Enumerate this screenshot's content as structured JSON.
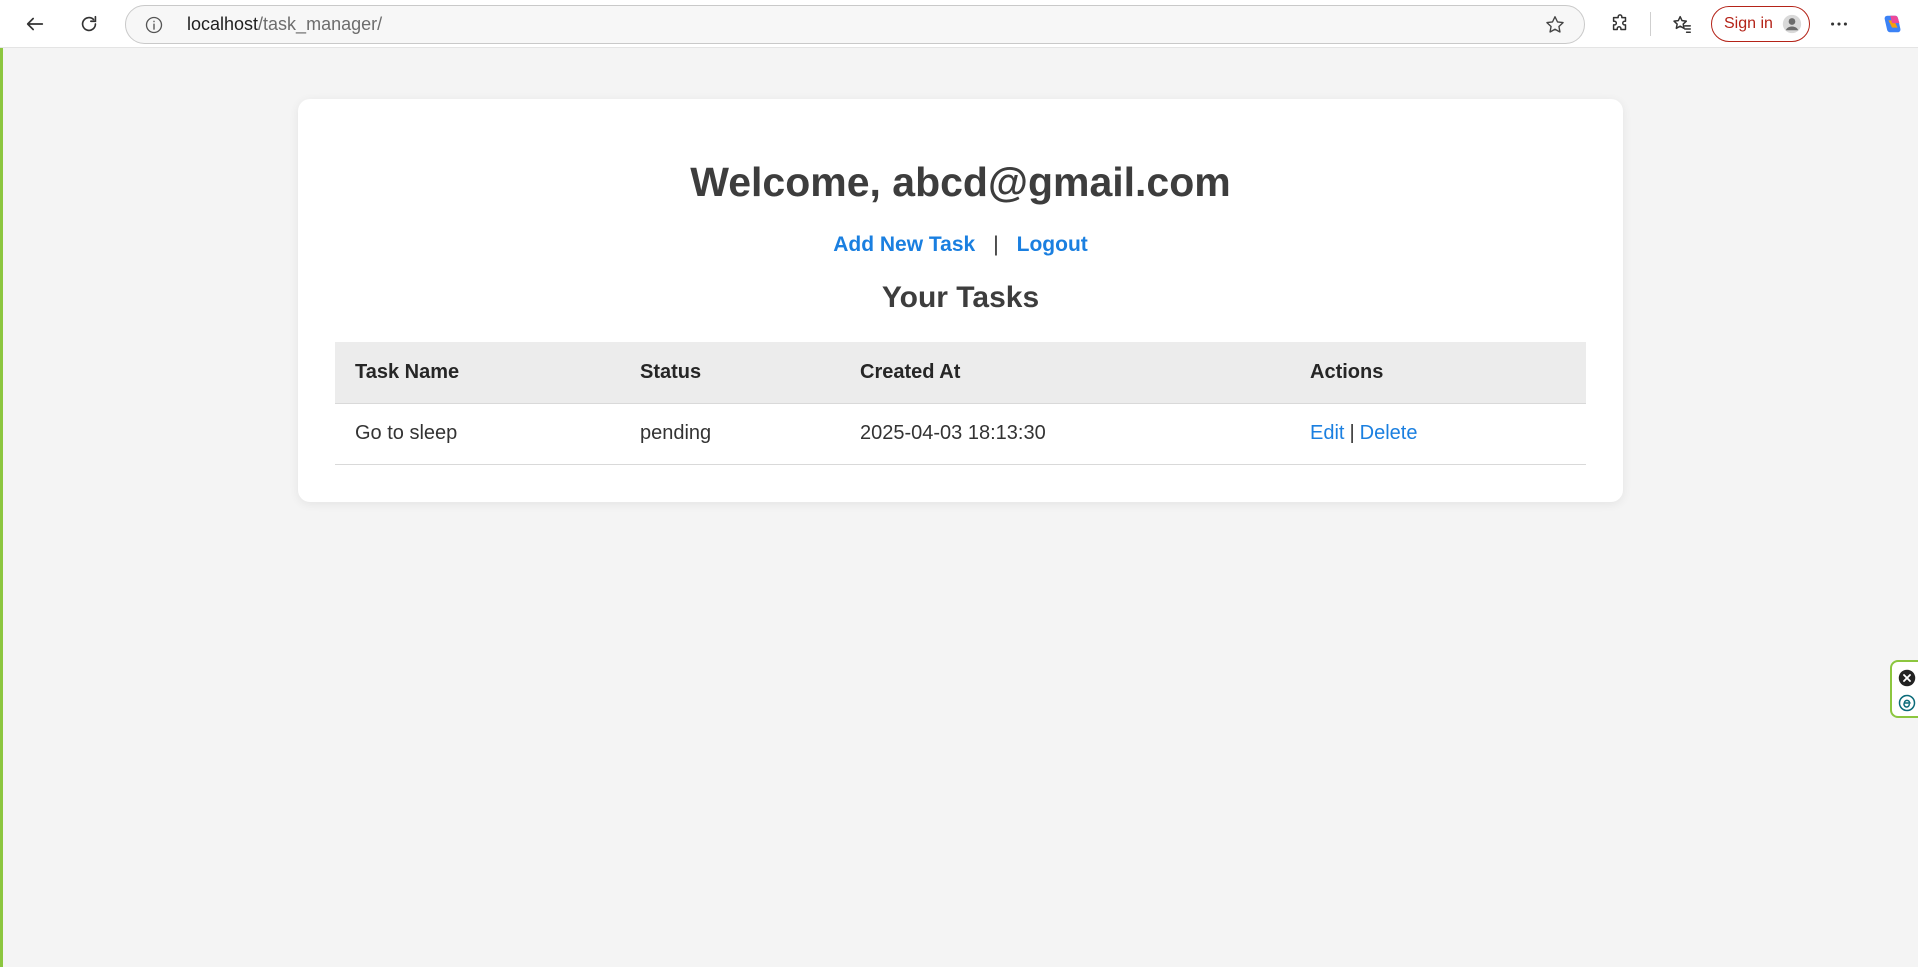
{
  "browser": {
    "url_host": "localhost",
    "url_path": "/task_manager/",
    "signin_label": "Sign in"
  },
  "page": {
    "welcome": "Welcome, abcd@gmail.com",
    "add_task_link": "Add New Task",
    "nav_separator": "|",
    "logout_link": "Logout",
    "tasks_heading": "Your Tasks"
  },
  "table": {
    "headers": [
      "Task Name",
      "Status",
      "Created At",
      "Actions"
    ],
    "rows": [
      {
        "task_name": "Go to sleep",
        "status": "pending",
        "created_at": "2025-04-03 18:13:30",
        "edit_label": "Edit",
        "action_separator": "|",
        "delete_label": "Delete"
      }
    ]
  },
  "colors": {
    "accent_link": "#1a7fe0",
    "signin_red": "#b42318",
    "page_bg": "#f4f4f4",
    "header_bg": "#ececec",
    "side_border": "#8cc63f"
  },
  "icons": {
    "back": "back-arrow-icon",
    "reload": "reload-icon",
    "info": "info-icon",
    "favorite": "star-icon",
    "extensions": "puzzle-icon",
    "favorites_list": "favorites-icon",
    "profile": "profile-icon",
    "more": "more-dots-icon",
    "copilot": "copilot-icon"
  }
}
